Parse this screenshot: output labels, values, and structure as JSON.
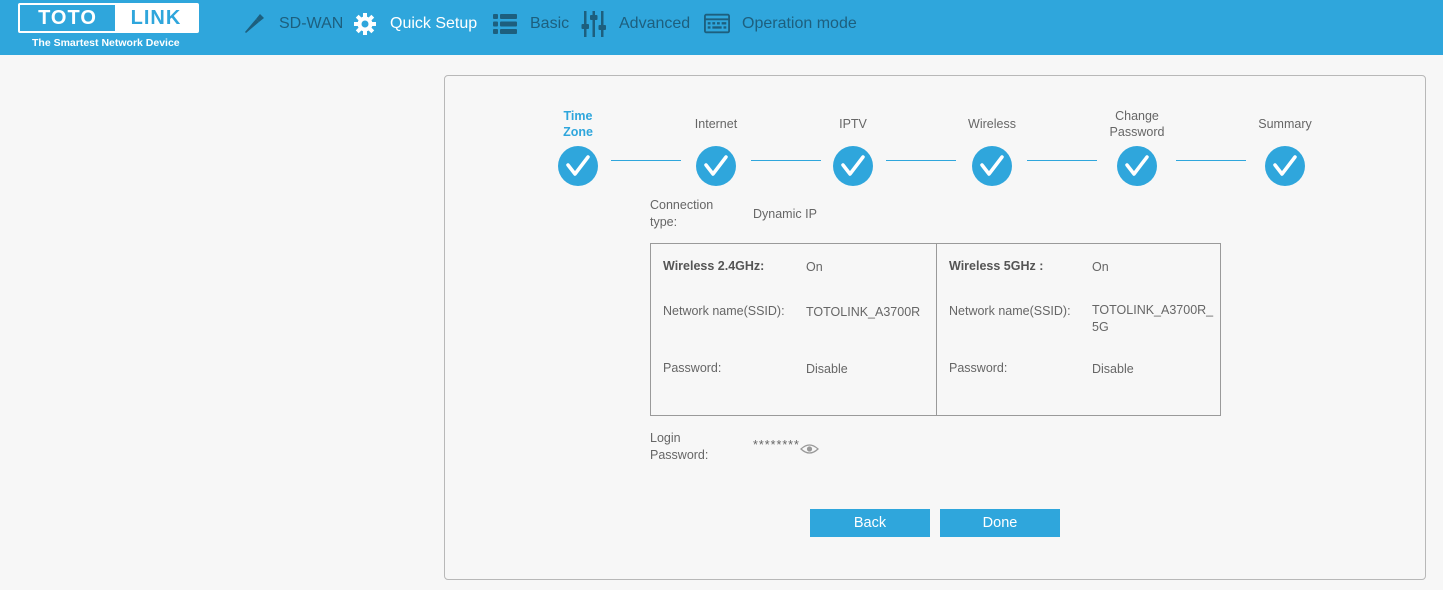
{
  "brand": {
    "logo_left": "TOTO",
    "logo_right": "LINK",
    "tagline": "The Smartest Network Device"
  },
  "nav": {
    "items": [
      {
        "label": "SD-WAN",
        "icon": "wrench-icon",
        "active": false
      },
      {
        "label": "Quick Setup",
        "icon": "gear-icon",
        "active": true
      },
      {
        "label": "Basic",
        "icon": "list-icon",
        "active": false
      },
      {
        "label": "Advanced",
        "icon": "sliders-icon",
        "active": false
      },
      {
        "label": "Operation mode",
        "icon": "keyboard-icon",
        "active": false
      }
    ]
  },
  "colors": {
    "accent": "#2fa6dc",
    "header_text": "#1d5f7e"
  },
  "steps": [
    {
      "label_line1": "Time",
      "label_line2": "Zone",
      "current": true
    },
    {
      "label_line1": "Internet",
      "label_line2": ""
    },
    {
      "label_line1": "IPTV",
      "label_line2": ""
    },
    {
      "label_line1": "Wireless",
      "label_line2": ""
    },
    {
      "label_line1": "Change",
      "label_line2": "Password"
    },
    {
      "label_line1": "Summary",
      "label_line2": ""
    }
  ],
  "summary": {
    "connection_label_1": "Connection",
    "connection_label_2": "type:",
    "connection_value": "Dynamic IP",
    "w24": {
      "title": "Wireless 2.4GHz:",
      "status": "On",
      "ssid_label": "Network name(SSID):",
      "ssid_value": "TOTOLINK_A3700R",
      "password_label": "Password:",
      "password_value": "Disable"
    },
    "w5": {
      "title": "Wireless 5GHz :",
      "status": "On",
      "ssid_label": "Network name(SSID):",
      "ssid_value_1": "TOTOLINK_A3700R_",
      "ssid_value_2": "5G",
      "password_label": "Password:",
      "password_value": "Disable"
    },
    "login_label_1": "Login",
    "login_label_2": "Password:",
    "login_value": "********"
  },
  "buttons": {
    "back": "Back",
    "done": "Done"
  }
}
